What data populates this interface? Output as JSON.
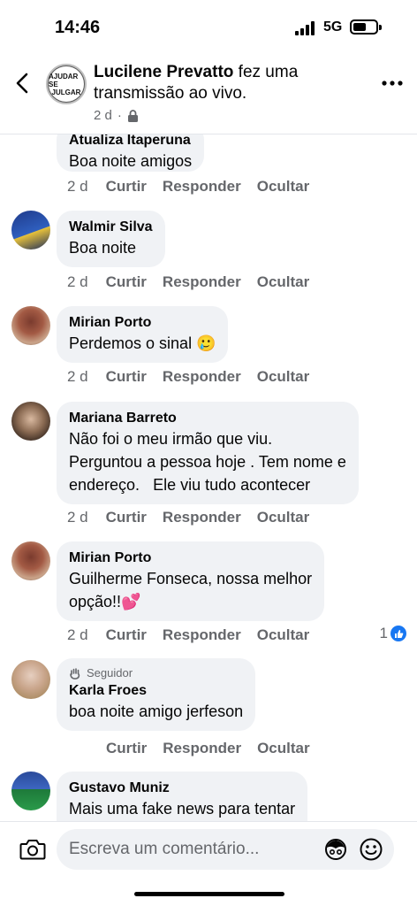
{
  "status_bar": {
    "time": "14:46",
    "network": "5G",
    "battery_level": 0.5
  },
  "header": {
    "author": "Lucilene Prevatto",
    "action": "fez uma transmissão ao vivo.",
    "time": "2 d",
    "privacy_icon": "lock-icon",
    "avatar_text_line1": "AJUDAR SE",
    "avatar_text_line2": "JULGAR",
    "back_icon": "chevron-left-icon",
    "more_icon": "more-horizontal-icon"
  },
  "actions": {
    "like": "Curtir",
    "reply": "Responder",
    "hide": "Ocultar"
  },
  "comments": [
    {
      "author": "Atualiza Itaperuna",
      "text": "Boa noite amigos",
      "time": "2 d"
    },
    {
      "author": "Walmir Silva",
      "text": "Boa noite",
      "time": "2 d"
    },
    {
      "author": "Mirian Porto",
      "text": "Perdemos o sinal 🥲",
      "time": "2 d"
    },
    {
      "author": "Mariana Barreto",
      "text_lines": [
        "Não foi o meu irmão que viu.",
        "Perguntou a pessoa hoje . Tem nome e",
        "endereço.   Ele viu tudo acontecer"
      ],
      "time": "2 d"
    },
    {
      "author": "Mirian Porto",
      "text_lines": [
        "Guilherme Fonseca, nossa melhor",
        "opção!!💕"
      ],
      "time": "2 d",
      "reaction_count": "1",
      "reaction_icon": "like-icon"
    },
    {
      "badge": "Seguidor",
      "badge_icon": "wave-hand-icon",
      "author": "Karla Froes",
      "text": "boa noite amigo jerfeson",
      "time": ""
    },
    {
      "author": "Gustavo Muniz",
      "text": "Mais uma fake news para tentar"
    }
  ],
  "composer": {
    "placeholder": "Escreva um comentário...",
    "camera_icon": "camera-icon",
    "avatar_icon": "avatar-sticker-icon",
    "emoji_icon": "emoji-icon"
  },
  "colors": {
    "bubble": "#f0f2f5",
    "secondary_text": "#65676b",
    "like_blue": "#1877f2"
  }
}
